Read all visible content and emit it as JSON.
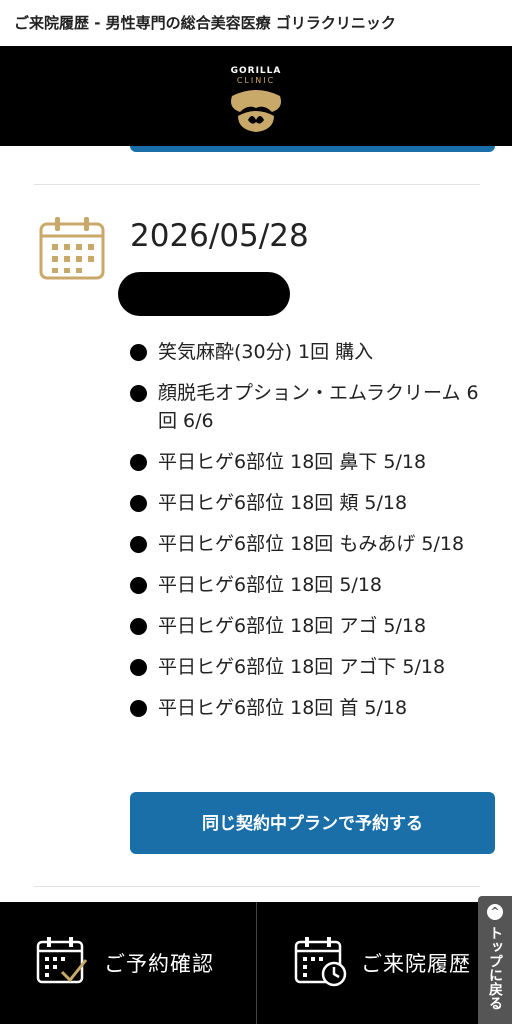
{
  "page_title": "ご来院履歴 - 男性専門の総合美容医療 ゴリラクリニック",
  "logo": {
    "line1": "GORILLA",
    "line2": "CLINIC"
  },
  "visit": {
    "date": "2026/05/28",
    "plans": [
      "笑気麻酔(30分) 1回 購入",
      "顔脱毛オプション・エムラクリーム 6回 6/6",
      "平日ヒゲ6部位 18回 鼻下 5/18",
      "平日ヒゲ6部位 18回 頬 5/18",
      "平日ヒゲ6部位 18回 もみあげ 5/18",
      "平日ヒゲ6部位 18回 5/18",
      "平日ヒゲ6部位 18回 アゴ 5/18",
      "平日ヒゲ6部位 18回 アゴ下 5/18",
      "平日ヒゲ6部位 18回 首 5/18"
    ],
    "reserve_button": "同じ契約中プランで予約する"
  },
  "bottom_nav": {
    "confirm_label": "ご予約確認",
    "history_label": "ご来院履歴"
  },
  "to_top_label": "トップに戻る",
  "colors": {
    "accent_blue": "#1b6fa8",
    "gold": "#c9a96a",
    "header_bg": "#000000"
  }
}
